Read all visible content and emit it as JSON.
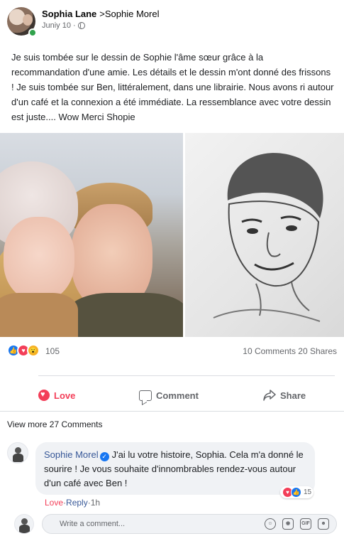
{
  "post": {
    "author": "Sophia Lane",
    "target": ">Sophie Morel",
    "date": "Juniy 10",
    "dot": "·",
    "text": "Je suis tombée sur le dessin de Sophie l'âme sœur grâce à la recommandation d'une amie. Les détails et le dessin m'ont donné des frissons ! Je suis tombée sur Ben, littéralement, dans une librairie. Nous avons ri autour d'un café et la connexion a été immédiate. La ressemblance avec votre dessin est juste.... Wow Merci Shopie"
  },
  "stats": {
    "reactions_count": "105",
    "comments_shares": "10 Comments 20 Shares"
  },
  "actions": {
    "love": "Love",
    "comment": "Comment",
    "share": "Share"
  },
  "view_more": "View more 27 Comments",
  "comment": {
    "author": "Sophie Morel",
    "text": "J'ai lu votre histoire, Sophia. Cela m'a donné le sourire ! Je vous souhaite d'innombrables rendez-vous autour d'un café avec Ben !",
    "reaction_count": "15",
    "love_link": "Love",
    "sep1": " · ",
    "reply_link": "Reply",
    "sep2": " · ",
    "time": "1h"
  },
  "compose": {
    "placeholder": "Write a comment..."
  },
  "icons": {
    "like": "like-icon",
    "love": "heart-icon",
    "wow": "wow-icon",
    "globe": "globe-icon",
    "verified": "verified-icon"
  },
  "colors": {
    "love": "#f33e58",
    "like": "#1877f2",
    "link": "#385898",
    "muted": "#65676b",
    "online": "#31a24c"
  }
}
